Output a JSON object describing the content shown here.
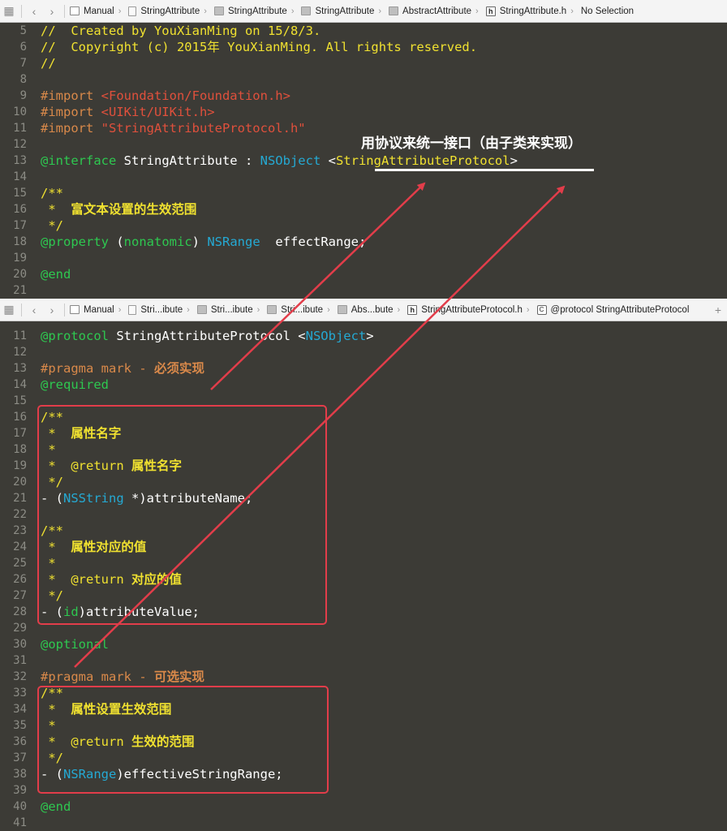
{
  "top_bar": {
    "crumbs": [
      {
        "label": "Manual",
        "icon": "project-icon"
      },
      {
        "label": "StringAttribute",
        "icon": "file-icon"
      },
      {
        "label": "StringAttribute",
        "icon": "folder-icon"
      },
      {
        "label": "StringAttribute",
        "icon": "folder-icon"
      },
      {
        "label": "AbstractAttribute",
        "icon": "folder-icon"
      },
      {
        "label": "StringAttribute.h",
        "icon": "header-icon"
      },
      {
        "label": "No Selection",
        "icon": ""
      }
    ]
  },
  "bottom_bar": {
    "crumbs": [
      {
        "label": "Manual",
        "icon": "project-icon"
      },
      {
        "label": "Stri...ibute",
        "icon": "file-icon"
      },
      {
        "label": "Stri...ibute",
        "icon": "folder-icon"
      },
      {
        "label": "Stri...ibute",
        "icon": "folder-icon"
      },
      {
        "label": "Abs...bute",
        "icon": "folder-icon"
      },
      {
        "label": "StringAttributeProtocol.h",
        "icon": "header-icon"
      },
      {
        "label": "@protocol StringAttributeProtocol",
        "icon": "protocol-icon"
      }
    ]
  },
  "annotation": "用协议来统一接口（由子类来实现）",
  "top_editor": [
    {
      "n": "5",
      "segs": [
        [
          "cmt",
          "//  Created by YouXianMing on 15/8/3."
        ]
      ]
    },
    {
      "n": "6",
      "segs": [
        [
          "cmt",
          "//  Copyright (c) 2015年 YouXianMing. All rights reserved."
        ]
      ]
    },
    {
      "n": "7",
      "segs": [
        [
          "cmt",
          "//"
        ]
      ]
    },
    {
      "n": "8",
      "segs": []
    },
    {
      "n": "9",
      "segs": [
        [
          "pp",
          "#import "
        ],
        [
          "str",
          "<Foundation/Foundation.h>"
        ]
      ]
    },
    {
      "n": "10",
      "segs": [
        [
          "pp",
          "#import "
        ],
        [
          "str",
          "<UIKit/UIKit.h>"
        ]
      ]
    },
    {
      "n": "11",
      "segs": [
        [
          "pp",
          "#import "
        ],
        [
          "str",
          "\"StringAttributeProtocol.h\""
        ]
      ]
    },
    {
      "n": "12",
      "segs": []
    },
    {
      "n": "13",
      "segs": [
        [
          "kw",
          "@interface"
        ],
        [
          "pl",
          " StringAttribute : "
        ],
        [
          "tp",
          "NSObject"
        ],
        [
          "pl",
          " <"
        ],
        [
          "cmt",
          "StringAttributeProtocol"
        ],
        [
          "pl",
          ">"
        ]
      ]
    },
    {
      "n": "14",
      "segs": []
    },
    {
      "n": "15",
      "segs": [
        [
          "cmt",
          "/**"
        ]
      ]
    },
    {
      "n": "16",
      "segs": [
        [
          "cmt",
          " *  "
        ],
        [
          "cmt cjk",
          "富文本设置的生效范围"
        ]
      ]
    },
    {
      "n": "17",
      "segs": [
        [
          "cmt",
          " */"
        ]
      ]
    },
    {
      "n": "18",
      "segs": [
        [
          "kw",
          "@property"
        ],
        [
          "pl",
          " ("
        ],
        [
          "kw",
          "nonatomic"
        ],
        [
          "pl",
          ") "
        ],
        [
          "tp",
          "NSRange"
        ],
        [
          "pl",
          "  effectRange;"
        ]
      ]
    },
    {
      "n": "19",
      "segs": []
    },
    {
      "n": "20",
      "segs": [
        [
          "kw",
          "@end"
        ]
      ]
    },
    {
      "n": "21",
      "segs": []
    }
  ],
  "bottom_editor": [
    {
      "n": "11",
      "segs": [
        [
          "kw",
          "@protocol"
        ],
        [
          "pl",
          " StringAttributeProtocol <"
        ],
        [
          "tp",
          "NSObject"
        ],
        [
          "pl",
          ">"
        ]
      ]
    },
    {
      "n": "12",
      "segs": []
    },
    {
      "n": "13",
      "segs": [
        [
          "pp",
          "#pragma mark - "
        ],
        [
          "pp cjk",
          "必须实现"
        ]
      ]
    },
    {
      "n": "14",
      "segs": [
        [
          "kw",
          "@required"
        ]
      ]
    },
    {
      "n": "15",
      "segs": []
    },
    {
      "n": "16",
      "segs": [
        [
          "cmt",
          "/**"
        ]
      ]
    },
    {
      "n": "17",
      "segs": [
        [
          "cmt",
          " *  "
        ],
        [
          "cmt cjk",
          "属性名字"
        ]
      ]
    },
    {
      "n": "18",
      "segs": [
        [
          "cmt",
          " *"
        ]
      ]
    },
    {
      "n": "19",
      "segs": [
        [
          "cmt",
          " *  @return "
        ],
        [
          "cmt cjk",
          "属性名字"
        ]
      ]
    },
    {
      "n": "20",
      "segs": [
        [
          "cmt",
          " */"
        ]
      ]
    },
    {
      "n": "21",
      "segs": [
        [
          "pl",
          "- ("
        ],
        [
          "tp",
          "NSString"
        ],
        [
          "pl",
          " *)attributeName;"
        ]
      ]
    },
    {
      "n": "22",
      "segs": []
    },
    {
      "n": "23",
      "segs": [
        [
          "cmt",
          "/**"
        ]
      ]
    },
    {
      "n": "24",
      "segs": [
        [
          "cmt",
          " *  "
        ],
        [
          "cmt cjk",
          "属性对应的值"
        ]
      ]
    },
    {
      "n": "25",
      "segs": [
        [
          "cmt",
          " *"
        ]
      ]
    },
    {
      "n": "26",
      "segs": [
        [
          "cmt",
          " *  @return "
        ],
        [
          "cmt cjk",
          "对应的值"
        ]
      ]
    },
    {
      "n": "27",
      "segs": [
        [
          "cmt",
          " */"
        ]
      ]
    },
    {
      "n": "28",
      "segs": [
        [
          "pl",
          "- ("
        ],
        [
          "kw",
          "id"
        ],
        [
          "pl",
          ")attributeValue;"
        ]
      ]
    },
    {
      "n": "29",
      "segs": []
    },
    {
      "n": "30",
      "segs": [
        [
          "kw",
          "@optional"
        ]
      ]
    },
    {
      "n": "31",
      "segs": []
    },
    {
      "n": "32",
      "segs": [
        [
          "pp",
          "#pragma mark - "
        ],
        [
          "pp cjk",
          "可选实现"
        ]
      ]
    },
    {
      "n": "33",
      "segs": [
        [
          "cmt",
          "/**"
        ]
      ]
    },
    {
      "n": "34",
      "segs": [
        [
          "cmt",
          " *  "
        ],
        [
          "cmt cjk",
          "属性设置生效范围"
        ]
      ]
    },
    {
      "n": "35",
      "segs": [
        [
          "cmt",
          " *"
        ]
      ]
    },
    {
      "n": "36",
      "segs": [
        [
          "cmt",
          " *  @return "
        ],
        [
          "cmt cjk",
          "生效的范围"
        ]
      ]
    },
    {
      "n": "37",
      "segs": [
        [
          "cmt",
          " */"
        ]
      ]
    },
    {
      "n": "38",
      "segs": [
        [
          "pl",
          "- ("
        ],
        [
          "tp",
          "NSRange"
        ],
        [
          "pl",
          ")effectiveStringRange;"
        ]
      ]
    },
    {
      "n": "39",
      "segs": []
    },
    {
      "n": "40",
      "segs": [
        [
          "kw",
          "@end"
        ]
      ]
    },
    {
      "n": "41",
      "segs": []
    }
  ]
}
